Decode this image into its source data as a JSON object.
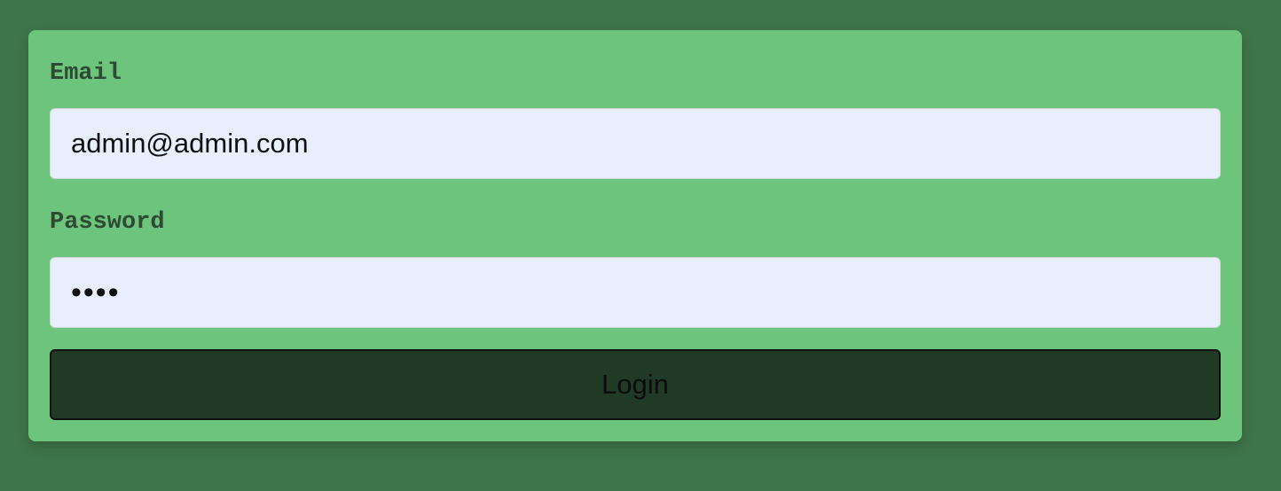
{
  "login_form": {
    "email_label": "Email",
    "email_value": "admin@admin.com",
    "password_label": "Password",
    "password_value": "1234",
    "login_button_label": "Login"
  },
  "colors": {
    "page_background": "#3e7548",
    "card_background": "#6dc47c",
    "input_background": "#e8eefc",
    "button_background": "#213a26",
    "label_text": "#2e4a33"
  }
}
